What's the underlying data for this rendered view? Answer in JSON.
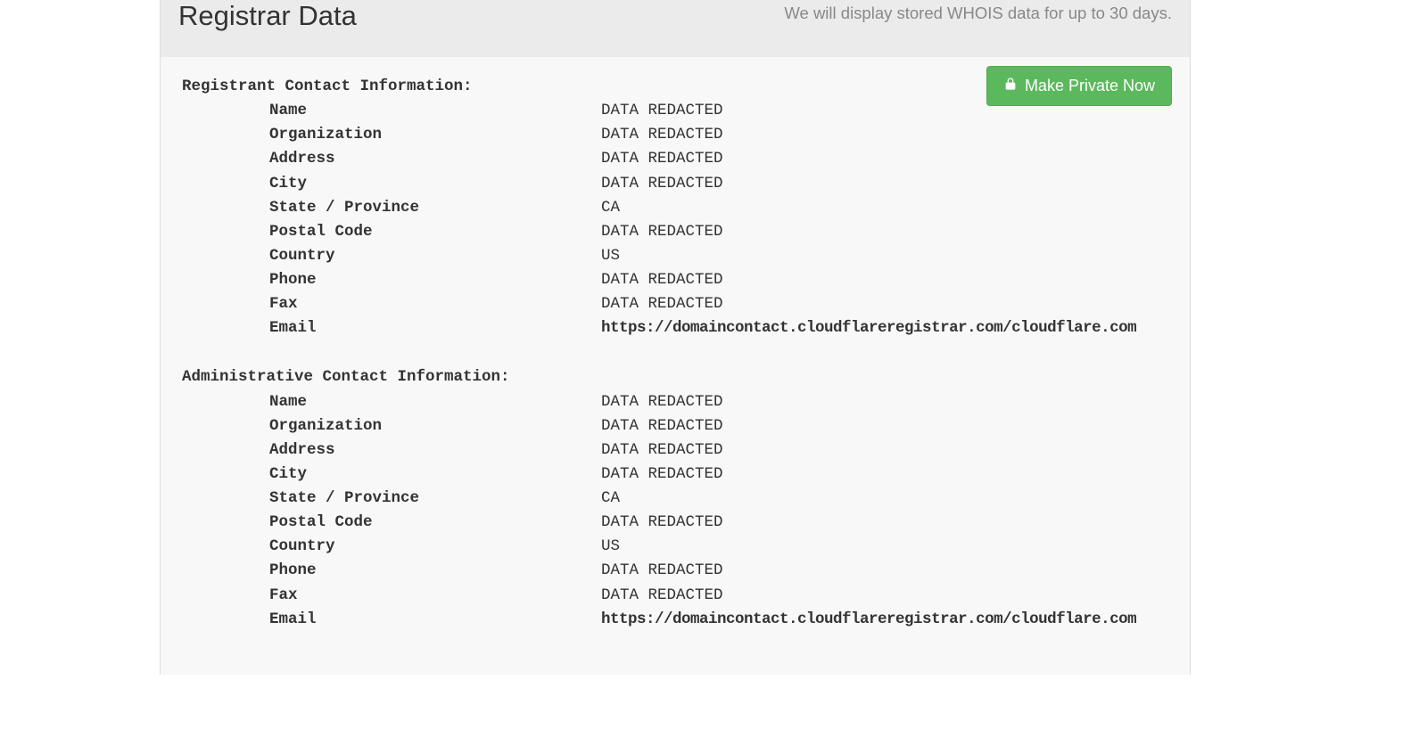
{
  "header": {
    "title": "Registrar Data",
    "notice": "We will display stored WHOIS data for up to 30 days.",
    "button_label": "Make Private Now"
  },
  "registrant": {
    "heading": "Registrant Contact Information:",
    "name_label": "Name",
    "name_value": "DATA REDACTED",
    "organization_label": "Organization",
    "organization_value": "DATA REDACTED",
    "address_label": "Address",
    "address_value": "DATA REDACTED",
    "city_label": "City",
    "city_value": "DATA REDACTED",
    "state_label": "State / Province",
    "state_value": "CA",
    "postal_label": "Postal Code",
    "postal_value": "DATA REDACTED",
    "country_label": "Country",
    "country_value": "US",
    "phone_label": "Phone",
    "phone_value": "DATA REDACTED",
    "fax_label": "Fax",
    "fax_value": "DATA REDACTED",
    "email_label": "Email",
    "email_value": "https://domaincontact.cloudflareregistrar.com/cloudflare.com"
  },
  "admin": {
    "heading": "Administrative Contact Information:",
    "name_label": "Name",
    "name_value": "DATA REDACTED",
    "organization_label": "Organization",
    "organization_value": "DATA REDACTED",
    "address_label": "Address",
    "address_value": "DATA REDACTED",
    "city_label": "City",
    "city_value": "DATA REDACTED",
    "state_label": "State / Province",
    "state_value": "CA",
    "postal_label": "Postal Code",
    "postal_value": "DATA REDACTED",
    "country_label": "Country",
    "country_value": "US",
    "phone_label": "Phone",
    "phone_value": "DATA REDACTED",
    "fax_label": "Fax",
    "fax_value": "DATA REDACTED",
    "email_label": "Email",
    "email_value": "https://domaincontact.cloudflareregistrar.com/cloudflare.com"
  }
}
